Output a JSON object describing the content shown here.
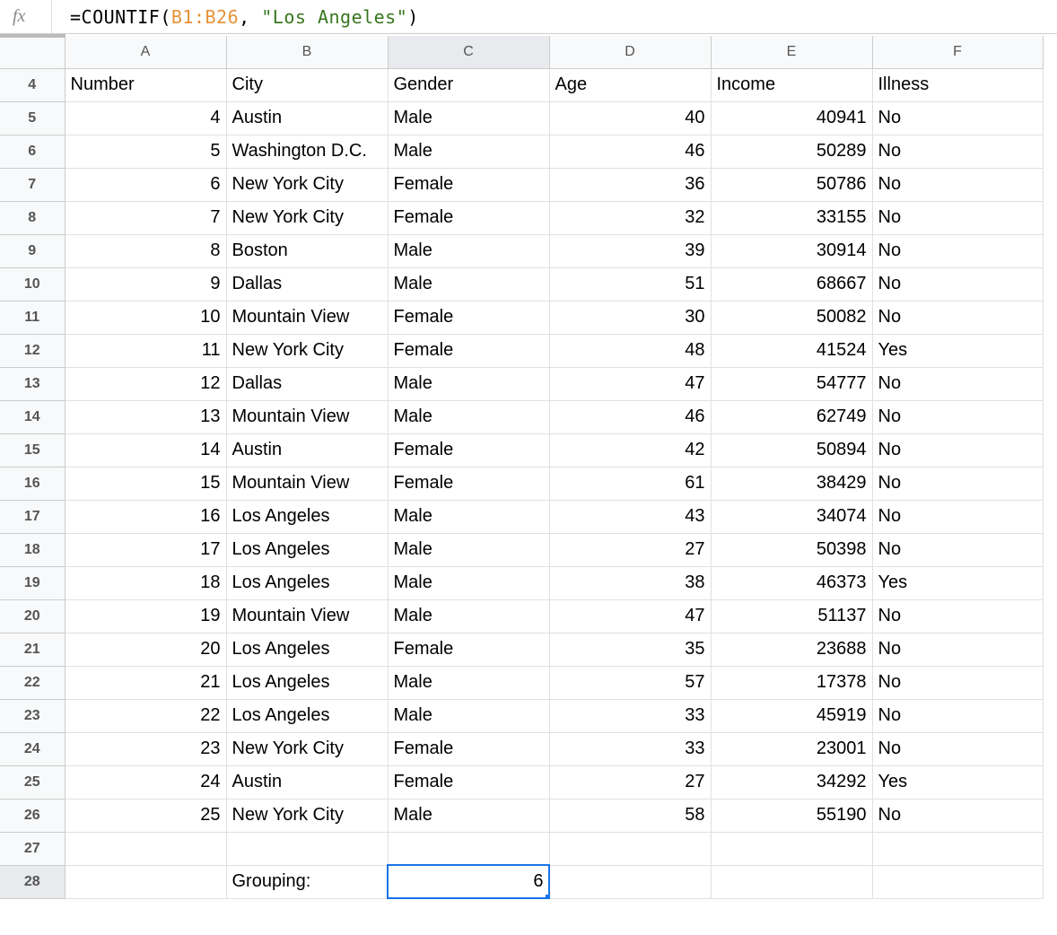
{
  "formula_bar": {
    "fx_label": "fx",
    "eq": "=",
    "fn": "COUNTIF",
    "open": "(",
    "range": "B1:B26",
    "comma": ", ",
    "str": "\"Los Angeles\"",
    "close": ")"
  },
  "columns": [
    "A",
    "B",
    "C",
    "D",
    "E",
    "F"
  ],
  "widths_class": [
    "col-A",
    "col-B",
    "col-C",
    "col-D",
    "col-E",
    "col-F"
  ],
  "active_col_index": 2,
  "rows": [
    {
      "n": 4,
      "cells": [
        "Number",
        "City",
        "Gender",
        "Age",
        "Income",
        "Illness"
      ],
      "align": [
        "txt",
        "txt",
        "txt",
        "txt",
        "txt",
        "txt"
      ]
    },
    {
      "n": 5,
      "cells": [
        "4",
        "Austin",
        "Male",
        "40",
        "40941",
        "No"
      ],
      "align": [
        "num",
        "txt",
        "txt",
        "num",
        "num",
        "txt"
      ]
    },
    {
      "n": 6,
      "cells": [
        "5",
        "Washington D.C.",
        "Male",
        "46",
        "50289",
        "No"
      ],
      "align": [
        "num",
        "txt",
        "txt",
        "num",
        "num",
        "txt"
      ]
    },
    {
      "n": 7,
      "cells": [
        "6",
        "New York City",
        "Female",
        "36",
        "50786",
        "No"
      ],
      "align": [
        "num",
        "txt",
        "txt",
        "num",
        "num",
        "txt"
      ]
    },
    {
      "n": 8,
      "cells": [
        "7",
        "New York City",
        "Female",
        "32",
        "33155",
        "No"
      ],
      "align": [
        "num",
        "txt",
        "txt",
        "num",
        "num",
        "txt"
      ]
    },
    {
      "n": 9,
      "cells": [
        "8",
        "Boston",
        "Male",
        "39",
        "30914",
        "No"
      ],
      "align": [
        "num",
        "txt",
        "txt",
        "num",
        "num",
        "txt"
      ]
    },
    {
      "n": 10,
      "cells": [
        "9",
        "Dallas",
        "Male",
        "51",
        "68667",
        "No"
      ],
      "align": [
        "num",
        "txt",
        "txt",
        "num",
        "num",
        "txt"
      ]
    },
    {
      "n": 11,
      "cells": [
        "10",
        "Mountain View",
        "Female",
        "30",
        "50082",
        "No"
      ],
      "align": [
        "num",
        "txt",
        "txt",
        "num",
        "num",
        "txt"
      ]
    },
    {
      "n": 12,
      "cells": [
        "11",
        "New York City",
        "Female",
        "48",
        "41524",
        "Yes"
      ],
      "align": [
        "num",
        "txt",
        "txt",
        "num",
        "num",
        "txt"
      ]
    },
    {
      "n": 13,
      "cells": [
        "12",
        "Dallas",
        "Male",
        "47",
        "54777",
        "No"
      ],
      "align": [
        "num",
        "txt",
        "txt",
        "num",
        "num",
        "txt"
      ]
    },
    {
      "n": 14,
      "cells": [
        "13",
        "Mountain View",
        "Male",
        "46",
        "62749",
        "No"
      ],
      "align": [
        "num",
        "txt",
        "txt",
        "num",
        "num",
        "txt"
      ]
    },
    {
      "n": 15,
      "cells": [
        "14",
        "Austin",
        "Female",
        "42",
        "50894",
        "No"
      ],
      "align": [
        "num",
        "txt",
        "txt",
        "num",
        "num",
        "txt"
      ]
    },
    {
      "n": 16,
      "cells": [
        "15",
        "Mountain View",
        "Female",
        "61",
        "38429",
        "No"
      ],
      "align": [
        "num",
        "txt",
        "txt",
        "num",
        "num",
        "txt"
      ]
    },
    {
      "n": 17,
      "cells": [
        "16",
        "Los Angeles",
        "Male",
        "43",
        "34074",
        "No"
      ],
      "align": [
        "num",
        "txt",
        "txt",
        "num",
        "num",
        "txt"
      ]
    },
    {
      "n": 18,
      "cells": [
        "17",
        "Los Angeles",
        "Male",
        "27",
        "50398",
        "No"
      ],
      "align": [
        "num",
        "txt",
        "txt",
        "num",
        "num",
        "txt"
      ]
    },
    {
      "n": 19,
      "cells": [
        "18",
        "Los Angeles",
        "Male",
        "38",
        "46373",
        "Yes"
      ],
      "align": [
        "num",
        "txt",
        "txt",
        "num",
        "num",
        "txt"
      ]
    },
    {
      "n": 20,
      "cells": [
        "19",
        "Mountain View",
        "Male",
        "47",
        "51137",
        "No"
      ],
      "align": [
        "num",
        "txt",
        "txt",
        "num",
        "num",
        "txt"
      ]
    },
    {
      "n": 21,
      "cells": [
        "20",
        "Los Angeles",
        "Female",
        "35",
        "23688",
        "No"
      ],
      "align": [
        "num",
        "txt",
        "txt",
        "num",
        "num",
        "txt"
      ]
    },
    {
      "n": 22,
      "cells": [
        "21",
        "Los Angeles",
        "Male",
        "57",
        "17378",
        "No"
      ],
      "align": [
        "num",
        "txt",
        "txt",
        "num",
        "num",
        "txt"
      ]
    },
    {
      "n": 23,
      "cells": [
        "22",
        "Los Angeles",
        "Male",
        "33",
        "45919",
        "No"
      ],
      "align": [
        "num",
        "txt",
        "txt",
        "num",
        "num",
        "txt"
      ]
    },
    {
      "n": 24,
      "cells": [
        "23",
        "New York City",
        "Female",
        "33",
        "23001",
        "No"
      ],
      "align": [
        "num",
        "txt",
        "txt",
        "num",
        "num",
        "txt"
      ]
    },
    {
      "n": 25,
      "cells": [
        "24",
        "Austin",
        "Female",
        "27",
        "34292",
        "Yes"
      ],
      "align": [
        "num",
        "txt",
        "txt",
        "num",
        "num",
        "txt"
      ]
    },
    {
      "n": 26,
      "cells": [
        "25",
        "New York City",
        "Male",
        "58",
        "55190",
        "No"
      ],
      "align": [
        "num",
        "txt",
        "txt",
        "num",
        "num",
        "txt"
      ]
    },
    {
      "n": 27,
      "cells": [
        "",
        "",
        "",
        "",
        "",
        ""
      ],
      "align": [
        "txt",
        "txt",
        "txt",
        "txt",
        "txt",
        "txt"
      ]
    },
    {
      "n": 28,
      "cells": [
        "",
        "Grouping:",
        "6",
        "",
        "",
        ""
      ],
      "align": [
        "txt",
        "txt",
        "num",
        "txt",
        "txt",
        "txt"
      ],
      "active_col": 2
    }
  ]
}
